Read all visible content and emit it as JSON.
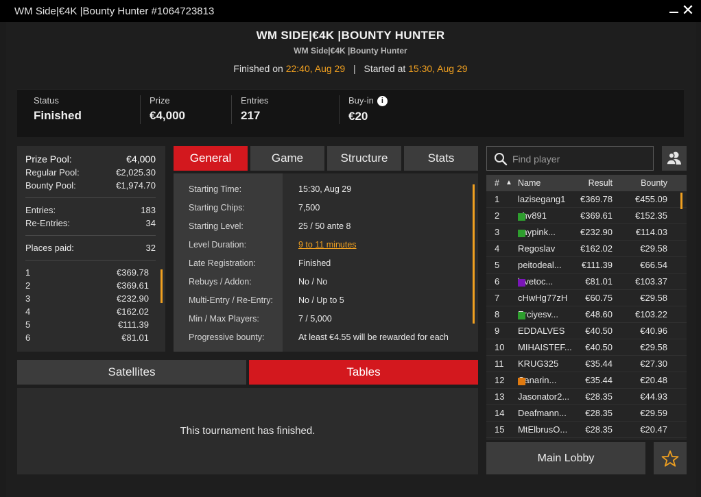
{
  "window": {
    "title": "WM Side|€4K  |Bounty Hunter #1064723813"
  },
  "header": {
    "title": "WM SIDE|€4K  |BOUNTY HUNTER",
    "subtitle": "WM Side|€4K  |Bounty Hunter",
    "finished_label": "Finished on",
    "finished_time": "22:40, Aug 29",
    "separator": "|",
    "started_label": "Started at",
    "started_time": "15:30, Aug 29"
  },
  "summary": {
    "status_label": "Status",
    "status_value": "Finished",
    "prize_label": "Prize",
    "prize_value": "€4,000",
    "entries_label": "Entries",
    "entries_value": "217",
    "buyin_label": "Buy-in",
    "buyin_value": "€20",
    "info_icon": "i"
  },
  "prize_pool": {
    "rows": [
      {
        "label": "Prize Pool:",
        "value": "€4,000"
      },
      {
        "label": "Regular Pool:",
        "value": "€2,025.30"
      },
      {
        "label": "Bounty Pool:",
        "value": "€1,974.70"
      }
    ],
    "entries": [
      {
        "label": "Entries:",
        "value": "183"
      },
      {
        "label": "Re-Entries:",
        "value": "34"
      }
    ],
    "places_label": "Places paid:",
    "places_value": "32",
    "payouts": [
      {
        "place": "1",
        "amount": "€369.78"
      },
      {
        "place": "2",
        "amount": "€369.61"
      },
      {
        "place": "3",
        "amount": "€232.90"
      },
      {
        "place": "4",
        "amount": "€162.02"
      },
      {
        "place": "5",
        "amount": "€111.39"
      },
      {
        "place": "6",
        "amount": "€81.01"
      }
    ]
  },
  "tabs": [
    {
      "label": "General",
      "active": true
    },
    {
      "label": "Game",
      "active": false
    },
    {
      "label": "Structure",
      "active": false
    },
    {
      "label": "Stats",
      "active": false
    }
  ],
  "general": [
    {
      "key": "Starting Time:",
      "value": "15:30, Aug 29"
    },
    {
      "key": "Starting Chips:",
      "value": "7,500"
    },
    {
      "key": "Starting Level:",
      "value": "25 / 50 ante 8"
    },
    {
      "key": "Level Duration:",
      "value": "9 to 11 minutes",
      "link": true
    },
    {
      "key": "Late Registration:",
      "value": "Finished"
    },
    {
      "key": "Rebuys / Addon:",
      "value": "No / No"
    },
    {
      "key": "Multi-Entry / Re-Entry:",
      "value": "No / Up to 5"
    },
    {
      "key": "Min / Max Players:",
      "value": "7 / 5,000"
    },
    {
      "key": "Progressive bounty:",
      "value": "At least €4.55 will be rewarded for each"
    }
  ],
  "bottom_tabs": [
    {
      "label": "Satellites",
      "active": false
    },
    {
      "label": "Tables",
      "active": true
    }
  ],
  "finished_message": "This tournament has finished.",
  "search": {
    "placeholder": "Find player"
  },
  "players": {
    "headers": {
      "rank": "#",
      "sort": "▲",
      "name": "Name",
      "result": "Result",
      "bounty": "Bounty"
    },
    "rows": [
      {
        "rank": "1",
        "name": "lazisegang1",
        "result": "€369.78",
        "bounty": "€455.09",
        "flag": ""
      },
      {
        "rank": "2",
        "name": "chv891",
        "result": "€369.61",
        "bounty": "€152.35",
        "flag": "#2e9e2e"
      },
      {
        "rank": "3",
        "name": "saypink...",
        "result": "€232.90",
        "bounty": "€114.03",
        "flag": "#2e9e2e"
      },
      {
        "rank": "4",
        "name": "Regoslav",
        "result": "€162.02",
        "bounty": "€29.58",
        "flag": ""
      },
      {
        "rank": "5",
        "name": "peitodeal...",
        "result": "€111.39",
        "bounty": "€66.54",
        "flag": ""
      },
      {
        "rank": "6",
        "name": "lcvetoc...",
        "result": "€81.01",
        "bounty": "€103.37",
        "flag": "#7a16b8"
      },
      {
        "rank": "7",
        "name": "cHwHg77zH",
        "result": "€60.75",
        "bounty": "€29.58",
        "flag": ""
      },
      {
        "rank": "8",
        "name": "Erciyesv...",
        "result": "€48.60",
        "bounty": "€103.22",
        "flag": "#2e9e2e"
      },
      {
        "rank": "9",
        "name": "EDDALVES",
        "result": "€40.50",
        "bounty": "€40.96",
        "flag": ""
      },
      {
        "rank": "10",
        "name": "MIHAISTEF...",
        "result": "€40.50",
        "bounty": "€29.58",
        "flag": ""
      },
      {
        "rank": "11",
        "name": "KRUG325",
        "result": "€35.44",
        "bounty": "€27.30",
        "flag": ""
      },
      {
        "rank": "12",
        "name": "Canarin...",
        "result": "€35.44",
        "bounty": "€20.48",
        "flag": "#e07a10"
      },
      {
        "rank": "13",
        "name": "Jasonator2...",
        "result": "€28.35",
        "bounty": "€44.93",
        "flag": ""
      },
      {
        "rank": "14",
        "name": "Deafmann...",
        "result": "€28.35",
        "bounty": "€29.59",
        "flag": ""
      },
      {
        "rank": "15",
        "name": "MtElbrusO...",
        "result": "€28.35",
        "bounty": "€20.47",
        "flag": ""
      }
    ]
  },
  "main_lobby_label": "Main Lobby",
  "icons": {
    "search": "search-icon",
    "friends": "friends-icon",
    "favorite": "star-icon",
    "minimize": "minimize-icon",
    "close": "close-icon"
  },
  "colors": {
    "accent": "#d3181e",
    "highlight": "#f0a020"
  }
}
